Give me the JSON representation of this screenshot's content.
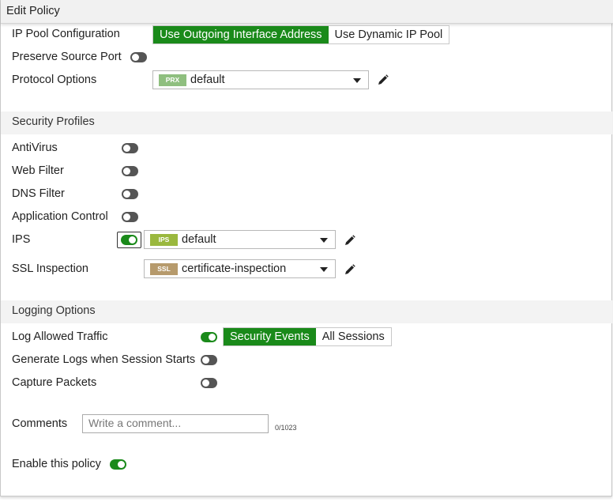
{
  "window": {
    "title": "Edit Policy"
  },
  "ip_pool": {
    "label": "IP Pool Configuration",
    "options": [
      "Use Outgoing Interface Address",
      "Use Dynamic IP Pool"
    ],
    "selected": "Use Outgoing Interface Address"
  },
  "preserve_source_port": {
    "label": "Preserve Source Port",
    "enabled": false
  },
  "protocol_options": {
    "label": "Protocol Options",
    "badge": "PRX",
    "badge_color": "#8fbf7f",
    "value": "default"
  },
  "security_profiles": {
    "header": "Security Profiles",
    "antivirus": {
      "label": "AntiVirus",
      "enabled": false
    },
    "web_filter": {
      "label": "Web Filter",
      "enabled": false
    },
    "dns_filter": {
      "label": "DNS Filter",
      "enabled": false
    },
    "application_control": {
      "label": "Application Control",
      "enabled": false
    },
    "ips": {
      "label": "IPS",
      "enabled": true,
      "badge": "IPS",
      "badge_color": "#9ab83e",
      "value": "default"
    },
    "ssl_inspection": {
      "label": "SSL Inspection",
      "badge": "SSL",
      "badge_color": "#b69a6c",
      "value": "certificate-inspection"
    }
  },
  "logging_options": {
    "header": "Logging Options",
    "log_allowed_traffic": {
      "label": "Log Allowed Traffic",
      "enabled": true,
      "options": [
        "Security Events",
        "All Sessions"
      ],
      "selected": "Security Events"
    },
    "generate_logs": {
      "label": "Generate Logs when Session Starts",
      "enabled": false
    },
    "capture_packets": {
      "label": "Capture Packets",
      "enabled": false
    }
  },
  "comments": {
    "label": "Comments",
    "placeholder": "Write a comment...",
    "counter": "0/1023"
  },
  "enable_policy": {
    "label": "Enable this policy",
    "enabled": true
  },
  "colors": {
    "accent": "#1a8a1a",
    "toggle_off": "#555555"
  }
}
